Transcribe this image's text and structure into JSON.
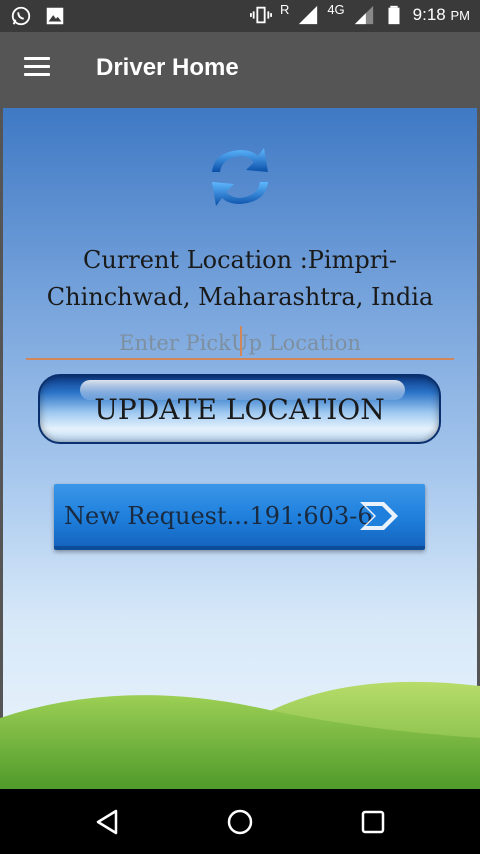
{
  "status_bar": {
    "time": "9:18",
    "ampm": "PM",
    "network_type": "4G",
    "roaming": "R",
    "icons": [
      "whatsapp-icon",
      "gallery-icon",
      "vibrate-icon",
      "signal-icon",
      "battery-icon"
    ]
  },
  "app_bar": {
    "title": "Driver Home",
    "menu_icon": "hamburger-menu-icon"
  },
  "main": {
    "refresh_icon": "refresh-arrows-icon",
    "current_location": "Current Location :Pimpri-Chinchwad, Maharashtra, India",
    "pickup_placeholder": "Enter PickUp Location",
    "pickup_value": "",
    "update_button_label": "UPDATE LOCATION",
    "request_button_label": "New Request...191:603-68",
    "request_arrow_icon": "chevron-right-icon"
  },
  "nav_bar": {
    "back_icon": "back-triangle-icon",
    "home_icon": "home-circle-icon",
    "recents_icon": "recents-square-icon"
  },
  "colors": {
    "status_bar": "#3a3a3a",
    "app_bar": "#555555",
    "accent_underline": "#d2875a",
    "request_button": "#1e7fdc"
  }
}
